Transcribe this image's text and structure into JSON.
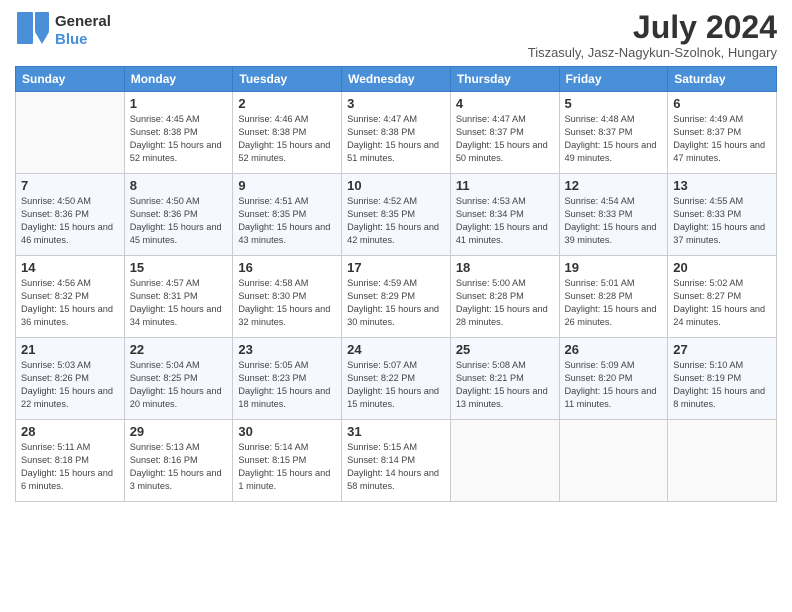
{
  "header": {
    "logo_line1": "General",
    "logo_line2": "Blue",
    "month_title": "July 2024",
    "subtitle": "Tiszasuly, Jasz-Nagykun-Szolnok, Hungary"
  },
  "days_of_week": [
    "Sunday",
    "Monday",
    "Tuesday",
    "Wednesday",
    "Thursday",
    "Friday",
    "Saturday"
  ],
  "weeks": [
    [
      {
        "day": "",
        "sunrise": "",
        "sunset": "",
        "daylight": ""
      },
      {
        "day": "1",
        "sunrise": "Sunrise: 4:45 AM",
        "sunset": "Sunset: 8:38 PM",
        "daylight": "Daylight: 15 hours and 52 minutes."
      },
      {
        "day": "2",
        "sunrise": "Sunrise: 4:46 AM",
        "sunset": "Sunset: 8:38 PM",
        "daylight": "Daylight: 15 hours and 52 minutes."
      },
      {
        "day": "3",
        "sunrise": "Sunrise: 4:47 AM",
        "sunset": "Sunset: 8:38 PM",
        "daylight": "Daylight: 15 hours and 51 minutes."
      },
      {
        "day": "4",
        "sunrise": "Sunrise: 4:47 AM",
        "sunset": "Sunset: 8:37 PM",
        "daylight": "Daylight: 15 hours and 50 minutes."
      },
      {
        "day": "5",
        "sunrise": "Sunrise: 4:48 AM",
        "sunset": "Sunset: 8:37 PM",
        "daylight": "Daylight: 15 hours and 49 minutes."
      },
      {
        "day": "6",
        "sunrise": "Sunrise: 4:49 AM",
        "sunset": "Sunset: 8:37 PM",
        "daylight": "Daylight: 15 hours and 47 minutes."
      }
    ],
    [
      {
        "day": "7",
        "sunrise": "Sunrise: 4:50 AM",
        "sunset": "Sunset: 8:36 PM",
        "daylight": "Daylight: 15 hours and 46 minutes."
      },
      {
        "day": "8",
        "sunrise": "Sunrise: 4:50 AM",
        "sunset": "Sunset: 8:36 PM",
        "daylight": "Daylight: 15 hours and 45 minutes."
      },
      {
        "day": "9",
        "sunrise": "Sunrise: 4:51 AM",
        "sunset": "Sunset: 8:35 PM",
        "daylight": "Daylight: 15 hours and 43 minutes."
      },
      {
        "day": "10",
        "sunrise": "Sunrise: 4:52 AM",
        "sunset": "Sunset: 8:35 PM",
        "daylight": "Daylight: 15 hours and 42 minutes."
      },
      {
        "day": "11",
        "sunrise": "Sunrise: 4:53 AM",
        "sunset": "Sunset: 8:34 PM",
        "daylight": "Daylight: 15 hours and 41 minutes."
      },
      {
        "day": "12",
        "sunrise": "Sunrise: 4:54 AM",
        "sunset": "Sunset: 8:33 PM",
        "daylight": "Daylight: 15 hours and 39 minutes."
      },
      {
        "day": "13",
        "sunrise": "Sunrise: 4:55 AM",
        "sunset": "Sunset: 8:33 PM",
        "daylight": "Daylight: 15 hours and 37 minutes."
      }
    ],
    [
      {
        "day": "14",
        "sunrise": "Sunrise: 4:56 AM",
        "sunset": "Sunset: 8:32 PM",
        "daylight": "Daylight: 15 hours and 36 minutes."
      },
      {
        "day": "15",
        "sunrise": "Sunrise: 4:57 AM",
        "sunset": "Sunset: 8:31 PM",
        "daylight": "Daylight: 15 hours and 34 minutes."
      },
      {
        "day": "16",
        "sunrise": "Sunrise: 4:58 AM",
        "sunset": "Sunset: 8:30 PM",
        "daylight": "Daylight: 15 hours and 32 minutes."
      },
      {
        "day": "17",
        "sunrise": "Sunrise: 4:59 AM",
        "sunset": "Sunset: 8:29 PM",
        "daylight": "Daylight: 15 hours and 30 minutes."
      },
      {
        "day": "18",
        "sunrise": "Sunrise: 5:00 AM",
        "sunset": "Sunset: 8:28 PM",
        "daylight": "Daylight: 15 hours and 28 minutes."
      },
      {
        "day": "19",
        "sunrise": "Sunrise: 5:01 AM",
        "sunset": "Sunset: 8:28 PM",
        "daylight": "Daylight: 15 hours and 26 minutes."
      },
      {
        "day": "20",
        "sunrise": "Sunrise: 5:02 AM",
        "sunset": "Sunset: 8:27 PM",
        "daylight": "Daylight: 15 hours and 24 minutes."
      }
    ],
    [
      {
        "day": "21",
        "sunrise": "Sunrise: 5:03 AM",
        "sunset": "Sunset: 8:26 PM",
        "daylight": "Daylight: 15 hours and 22 minutes."
      },
      {
        "day": "22",
        "sunrise": "Sunrise: 5:04 AM",
        "sunset": "Sunset: 8:25 PM",
        "daylight": "Daylight: 15 hours and 20 minutes."
      },
      {
        "day": "23",
        "sunrise": "Sunrise: 5:05 AM",
        "sunset": "Sunset: 8:23 PM",
        "daylight": "Daylight: 15 hours and 18 minutes."
      },
      {
        "day": "24",
        "sunrise": "Sunrise: 5:07 AM",
        "sunset": "Sunset: 8:22 PM",
        "daylight": "Daylight: 15 hours and 15 minutes."
      },
      {
        "day": "25",
        "sunrise": "Sunrise: 5:08 AM",
        "sunset": "Sunset: 8:21 PM",
        "daylight": "Daylight: 15 hours and 13 minutes."
      },
      {
        "day": "26",
        "sunrise": "Sunrise: 5:09 AM",
        "sunset": "Sunset: 8:20 PM",
        "daylight": "Daylight: 15 hours and 11 minutes."
      },
      {
        "day": "27",
        "sunrise": "Sunrise: 5:10 AM",
        "sunset": "Sunset: 8:19 PM",
        "daylight": "Daylight: 15 hours and 8 minutes."
      }
    ],
    [
      {
        "day": "28",
        "sunrise": "Sunrise: 5:11 AM",
        "sunset": "Sunset: 8:18 PM",
        "daylight": "Daylight: 15 hours and 6 minutes."
      },
      {
        "day": "29",
        "sunrise": "Sunrise: 5:13 AM",
        "sunset": "Sunset: 8:16 PM",
        "daylight": "Daylight: 15 hours and 3 minutes."
      },
      {
        "day": "30",
        "sunrise": "Sunrise: 5:14 AM",
        "sunset": "Sunset: 8:15 PM",
        "daylight": "Daylight: 15 hours and 1 minute."
      },
      {
        "day": "31",
        "sunrise": "Sunrise: 5:15 AM",
        "sunset": "Sunset: 8:14 PM",
        "daylight": "Daylight: 14 hours and 58 minutes."
      },
      {
        "day": "",
        "sunrise": "",
        "sunset": "",
        "daylight": ""
      },
      {
        "day": "",
        "sunrise": "",
        "sunset": "",
        "daylight": ""
      },
      {
        "day": "",
        "sunrise": "",
        "sunset": "",
        "daylight": ""
      }
    ]
  ]
}
